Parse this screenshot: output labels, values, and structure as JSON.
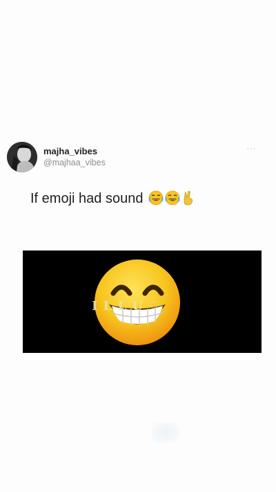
{
  "post": {
    "display_name": "majha_vibes",
    "username": "@majhaa_vibes",
    "more_glyph": "···",
    "text": "If emoji had sound",
    "text_emojis": [
      "face-with-tears-of-joy-icon",
      "face-with-tears-of-joy-icon",
      "victory-hand-icon"
    ]
  },
  "media": {
    "caption": "I L L U ♡",
    "emoji": "grinning-face-with-smiling-eyes-icon",
    "background": "#000000"
  },
  "colors": {
    "emoji_yellow": "#f7c51e",
    "emoji_orange": "#f09a14",
    "text": "#1f1f1f",
    "muted": "#8a8f94"
  }
}
